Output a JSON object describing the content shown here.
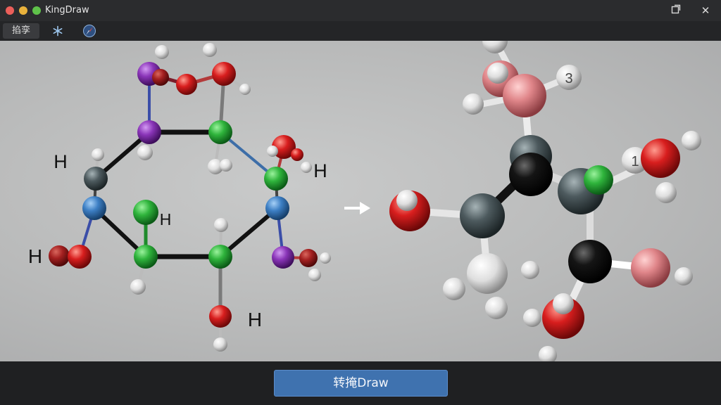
{
  "window": {
    "title": "KingDraw",
    "traffic_lights": [
      "#ec5f5a",
      "#e9b23c",
      "#5fc24a"
    ],
    "icons": [
      "restore-icon",
      "close-icon"
    ],
    "close_glyph": "✕"
  },
  "toolbar": {
    "tab_label": "掐孪",
    "icons": [
      "snowflake-icon",
      "compass-icon"
    ]
  },
  "viewport": {
    "arrow_icon": "right-arrow-icon",
    "left_molecule_labels": [
      "H",
      "H",
      "H",
      "H",
      "H"
    ],
    "right_molecule_labels": [
      "3",
      "1"
    ]
  },
  "bottom": {
    "convert_label": "转掩Draw"
  },
  "colors": {
    "accent": "#3f72af",
    "carbon_green": "#2fb43c",
    "oxygen_red": "#d81e1e",
    "purple": "#8a35b8",
    "blue": "#3d7fc4",
    "gray": "#4d5a5e",
    "pink": "#e0868a"
  }
}
